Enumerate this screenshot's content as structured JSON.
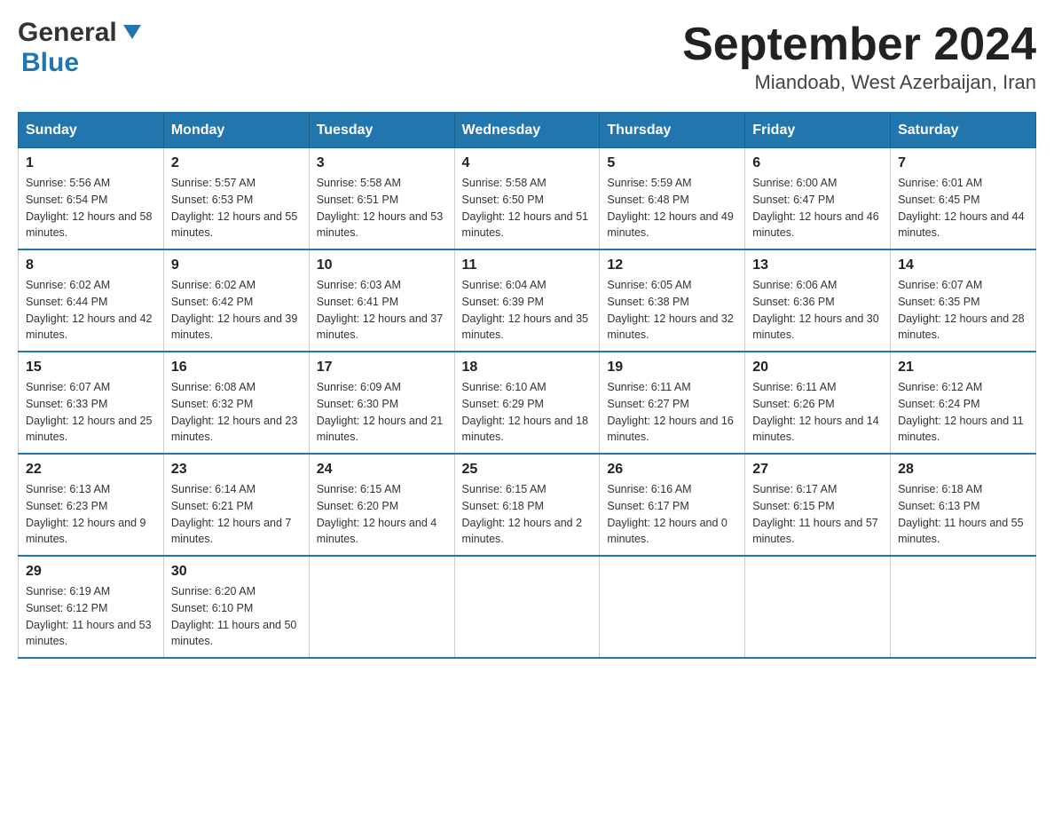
{
  "logo": {
    "text_general": "General",
    "text_blue": "Blue",
    "arrow_symbol": "▲"
  },
  "title": {
    "month_year": "September 2024",
    "location": "Miandoab, West Azerbaijan, Iran"
  },
  "days_of_week": [
    "Sunday",
    "Monday",
    "Tuesday",
    "Wednesday",
    "Thursday",
    "Friday",
    "Saturday"
  ],
  "weeks": [
    [
      {
        "day": "1",
        "sunrise": "Sunrise: 5:56 AM",
        "sunset": "Sunset: 6:54 PM",
        "daylight": "Daylight: 12 hours and 58 minutes."
      },
      {
        "day": "2",
        "sunrise": "Sunrise: 5:57 AM",
        "sunset": "Sunset: 6:53 PM",
        "daylight": "Daylight: 12 hours and 55 minutes."
      },
      {
        "day": "3",
        "sunrise": "Sunrise: 5:58 AM",
        "sunset": "Sunset: 6:51 PM",
        "daylight": "Daylight: 12 hours and 53 minutes."
      },
      {
        "day": "4",
        "sunrise": "Sunrise: 5:58 AM",
        "sunset": "Sunset: 6:50 PM",
        "daylight": "Daylight: 12 hours and 51 minutes."
      },
      {
        "day": "5",
        "sunrise": "Sunrise: 5:59 AM",
        "sunset": "Sunset: 6:48 PM",
        "daylight": "Daylight: 12 hours and 49 minutes."
      },
      {
        "day": "6",
        "sunrise": "Sunrise: 6:00 AM",
        "sunset": "Sunset: 6:47 PM",
        "daylight": "Daylight: 12 hours and 46 minutes."
      },
      {
        "day": "7",
        "sunrise": "Sunrise: 6:01 AM",
        "sunset": "Sunset: 6:45 PM",
        "daylight": "Daylight: 12 hours and 44 minutes."
      }
    ],
    [
      {
        "day": "8",
        "sunrise": "Sunrise: 6:02 AM",
        "sunset": "Sunset: 6:44 PM",
        "daylight": "Daylight: 12 hours and 42 minutes."
      },
      {
        "day": "9",
        "sunrise": "Sunrise: 6:02 AM",
        "sunset": "Sunset: 6:42 PM",
        "daylight": "Daylight: 12 hours and 39 minutes."
      },
      {
        "day": "10",
        "sunrise": "Sunrise: 6:03 AM",
        "sunset": "Sunset: 6:41 PM",
        "daylight": "Daylight: 12 hours and 37 minutes."
      },
      {
        "day": "11",
        "sunrise": "Sunrise: 6:04 AM",
        "sunset": "Sunset: 6:39 PM",
        "daylight": "Daylight: 12 hours and 35 minutes."
      },
      {
        "day": "12",
        "sunrise": "Sunrise: 6:05 AM",
        "sunset": "Sunset: 6:38 PM",
        "daylight": "Daylight: 12 hours and 32 minutes."
      },
      {
        "day": "13",
        "sunrise": "Sunrise: 6:06 AM",
        "sunset": "Sunset: 6:36 PM",
        "daylight": "Daylight: 12 hours and 30 minutes."
      },
      {
        "day": "14",
        "sunrise": "Sunrise: 6:07 AM",
        "sunset": "Sunset: 6:35 PM",
        "daylight": "Daylight: 12 hours and 28 minutes."
      }
    ],
    [
      {
        "day": "15",
        "sunrise": "Sunrise: 6:07 AM",
        "sunset": "Sunset: 6:33 PM",
        "daylight": "Daylight: 12 hours and 25 minutes."
      },
      {
        "day": "16",
        "sunrise": "Sunrise: 6:08 AM",
        "sunset": "Sunset: 6:32 PM",
        "daylight": "Daylight: 12 hours and 23 minutes."
      },
      {
        "day": "17",
        "sunrise": "Sunrise: 6:09 AM",
        "sunset": "Sunset: 6:30 PM",
        "daylight": "Daylight: 12 hours and 21 minutes."
      },
      {
        "day": "18",
        "sunrise": "Sunrise: 6:10 AM",
        "sunset": "Sunset: 6:29 PM",
        "daylight": "Daylight: 12 hours and 18 minutes."
      },
      {
        "day": "19",
        "sunrise": "Sunrise: 6:11 AM",
        "sunset": "Sunset: 6:27 PM",
        "daylight": "Daylight: 12 hours and 16 minutes."
      },
      {
        "day": "20",
        "sunrise": "Sunrise: 6:11 AM",
        "sunset": "Sunset: 6:26 PM",
        "daylight": "Daylight: 12 hours and 14 minutes."
      },
      {
        "day": "21",
        "sunrise": "Sunrise: 6:12 AM",
        "sunset": "Sunset: 6:24 PM",
        "daylight": "Daylight: 12 hours and 11 minutes."
      }
    ],
    [
      {
        "day": "22",
        "sunrise": "Sunrise: 6:13 AM",
        "sunset": "Sunset: 6:23 PM",
        "daylight": "Daylight: 12 hours and 9 minutes."
      },
      {
        "day": "23",
        "sunrise": "Sunrise: 6:14 AM",
        "sunset": "Sunset: 6:21 PM",
        "daylight": "Daylight: 12 hours and 7 minutes."
      },
      {
        "day": "24",
        "sunrise": "Sunrise: 6:15 AM",
        "sunset": "Sunset: 6:20 PM",
        "daylight": "Daylight: 12 hours and 4 minutes."
      },
      {
        "day": "25",
        "sunrise": "Sunrise: 6:15 AM",
        "sunset": "Sunset: 6:18 PM",
        "daylight": "Daylight: 12 hours and 2 minutes."
      },
      {
        "day": "26",
        "sunrise": "Sunrise: 6:16 AM",
        "sunset": "Sunset: 6:17 PM",
        "daylight": "Daylight: 12 hours and 0 minutes."
      },
      {
        "day": "27",
        "sunrise": "Sunrise: 6:17 AM",
        "sunset": "Sunset: 6:15 PM",
        "daylight": "Daylight: 11 hours and 57 minutes."
      },
      {
        "day": "28",
        "sunrise": "Sunrise: 6:18 AM",
        "sunset": "Sunset: 6:13 PM",
        "daylight": "Daylight: 11 hours and 55 minutes."
      }
    ],
    [
      {
        "day": "29",
        "sunrise": "Sunrise: 6:19 AM",
        "sunset": "Sunset: 6:12 PM",
        "daylight": "Daylight: 11 hours and 53 minutes."
      },
      {
        "day": "30",
        "sunrise": "Sunrise: 6:20 AM",
        "sunset": "Sunset: 6:10 PM",
        "daylight": "Daylight: 11 hours and 50 minutes."
      },
      null,
      null,
      null,
      null,
      null
    ]
  ]
}
